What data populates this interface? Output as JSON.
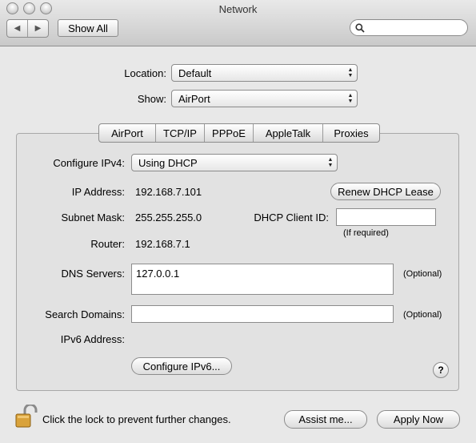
{
  "window": {
    "title": "Network"
  },
  "toolbar": {
    "back_glyph": "◀",
    "forward_glyph": "▶",
    "show_all_label": "Show All",
    "search_placeholder": ""
  },
  "location": {
    "label": "Location:",
    "value": "Default"
  },
  "show": {
    "label": "Show:",
    "value": "AirPort"
  },
  "tabs": [
    {
      "label": "AirPort"
    },
    {
      "label": "TCP/IP",
      "selected": true
    },
    {
      "label": "PPPoE"
    },
    {
      "label": "AppleTalk"
    },
    {
      "label": "Proxies"
    }
  ],
  "tcpip": {
    "configure_ipv4_label": "Configure IPv4:",
    "configure_ipv4_value": "Using DHCP",
    "ip_address_label": "IP Address:",
    "ip_address_value": "192.168.7.101",
    "renew_button": "Renew DHCP Lease",
    "subnet_mask_label": "Subnet Mask:",
    "subnet_mask_value": "255.255.255.0",
    "dhcp_client_id_label": "DHCP Client ID:",
    "dhcp_client_id_value": "",
    "if_required": "(If required)",
    "router_label": "Router:",
    "router_value": "192.168.7.1",
    "dns_servers_label": "DNS Servers:",
    "dns_servers_value": "127.0.0.1",
    "dns_optional": "(Optional)",
    "search_domains_label": "Search Domains:",
    "search_domains_value": "",
    "search_domains_optional": "(Optional)",
    "ipv6_address_label": "IPv6 Address:",
    "configure_ipv6_button": "Configure IPv6...",
    "help_glyph": "?"
  },
  "footer": {
    "lock_text": "Click the lock to prevent further changes.",
    "assist_button": "Assist me...",
    "apply_button": "Apply Now"
  },
  "icons": [
    "lock-icon",
    "search-icon",
    "help-icon"
  ]
}
